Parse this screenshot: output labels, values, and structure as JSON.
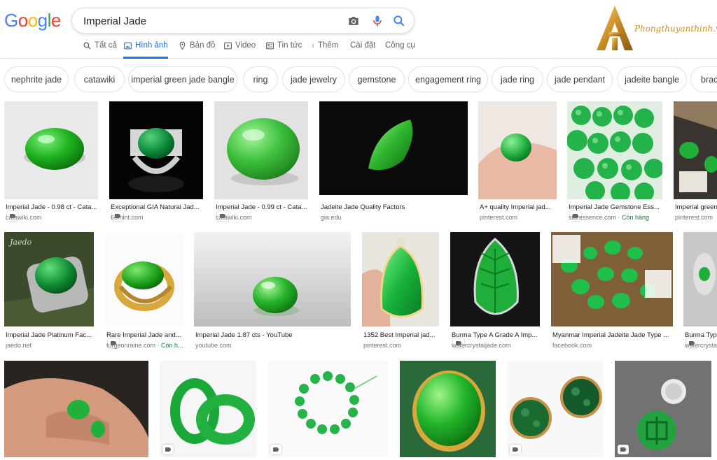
{
  "search": {
    "query": "Imperial Jade"
  },
  "tabs": [
    {
      "label": "Tất cả",
      "icon": "search-icon"
    },
    {
      "label": "Hình ảnh",
      "icon": "image-icon",
      "active": true
    },
    {
      "label": "Bản đồ",
      "icon": "map-pin-icon"
    },
    {
      "label": "Video",
      "icon": "video-icon"
    },
    {
      "label": "Tin tức",
      "icon": "news-icon"
    },
    {
      "label": "Thêm",
      "icon": "more-icon"
    },
    {
      "label": "Cài đặt"
    },
    {
      "label": "Công cụ"
    }
  ],
  "brand": {
    "text": "Phongthuyanthinh.vn"
  },
  "chips": [
    "nephrite jade",
    "catawiki",
    "imperial green jade bangle",
    "ring",
    "jade jewelry",
    "gemstone",
    "engagement ring",
    "jade ring",
    "jade pendant",
    "jadeite bangle",
    "brac"
  ],
  "rows": [
    [
      {
        "title": "Imperial Jade - 0.98 ct - Cata...",
        "source": "catawiki.com",
        "tag": true
      },
      {
        "title": "Exceptional GIA Natural Jad...",
        "source": "66mint.com",
        "tag": true
      },
      {
        "title": "Imperial Jade - 0.99 ct - Cata...",
        "source": "catawiki.com",
        "tag": true
      },
      {
        "title": "Jadeite Jade Quality Factors",
        "source": "gia.edu",
        "tag": false
      },
      {
        "title": "A+ quality Imperial jad...",
        "source": "pinterest.com",
        "tag": false
      },
      {
        "title": "Imperial Jade Gemstone Ess...",
        "source": "staressence.com",
        "stock": "Còn hàng",
        "tag": true
      },
      {
        "title": "Imperial green",
        "source": "pinterest.com",
        "tag": false
      }
    ],
    [
      {
        "title": "Imperial Jade Platinum Fac...",
        "source": "jaedo.net",
        "tag": false
      },
      {
        "title": "Rare Imperial Jade and...",
        "source": "turgeonraine.com",
        "stock": "Còn h...",
        "tag": true
      },
      {
        "title": "Imperial Jade 1.87 cts - YouTube",
        "source": "youtube.com",
        "tag": false
      },
      {
        "title": "1352 Best Imperial jad...",
        "source": "pinterest.com",
        "tag": false
      },
      {
        "title": "Burma Type A Grade A Imp...",
        "source": "watercrystaljade.com",
        "tag": true
      },
      {
        "title": "Myanmar Imperial Jadeite Jade Type ...",
        "source": "facebook.com",
        "tag": false
      },
      {
        "title": "Burma Type",
        "source": "watercrysta",
        "tag": true
      }
    ],
    [
      {
        "tag": false
      },
      {
        "tag": true
      },
      {
        "tag": true
      },
      {
        "tag": false
      },
      {
        "tag": true
      },
      {
        "tag": true
      }
    ]
  ]
}
